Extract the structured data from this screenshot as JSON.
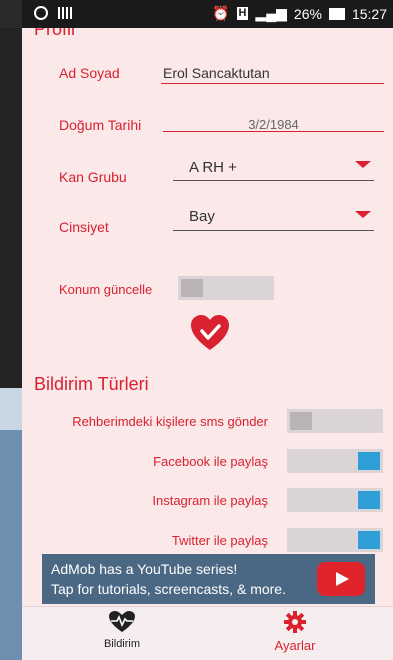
{
  "status_bar": {
    "battery_percent": "26%",
    "time": "15:27",
    "network_badge": "H"
  },
  "profile": {
    "section_title": "Profil",
    "name_label": "Ad Soyad",
    "name_value": "Erol Sancaktutan",
    "birth_label": "Doğum Tarihi",
    "birth_value": "3/2/1984",
    "blood_label": "Kan Grubu",
    "blood_value": "A RH +",
    "gender_label": "Cinsiyet",
    "gender_value": "Bay",
    "location_label": "Konum güncelle",
    "location_on": false
  },
  "notifications": {
    "section_title": "Bildirim Türleri",
    "items": [
      {
        "label": "Rehberimdeki kişilere sms gönder",
        "on": false
      },
      {
        "label": "Facebook ile paylaş",
        "on": true
      },
      {
        "label": "Instagram ile paylaş",
        "on": true
      },
      {
        "label": "Twitter ile paylaş",
        "on": true
      }
    ]
  },
  "ad": {
    "line1": "AdMob has a YouTube series!",
    "line2": "Tap for tutorials, screencasts, & more."
  },
  "nav": {
    "left_label": "Bildirim",
    "right_label": "Ayarlar"
  },
  "colors": {
    "accent": "#d9212f",
    "background": "#fbe9ea",
    "toggle_on": "#2e9fd6"
  }
}
